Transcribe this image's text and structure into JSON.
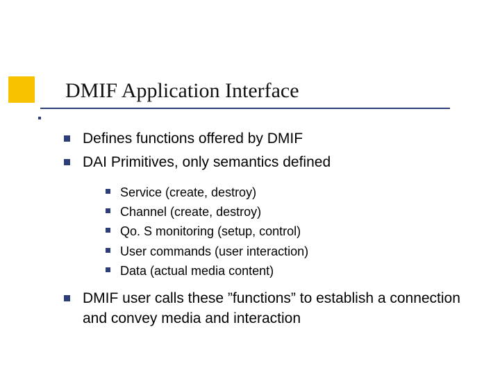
{
  "title": "DMIF Application Interface",
  "bullets": {
    "a": "Defines functions offered by DMIF",
    "b": "DAI Primitives, only semantics defined",
    "sub": {
      "s1": "Service (create, destroy)",
      "s2": "Channel (create, destroy)",
      "s3": "Qo. S monitoring (setup, control)",
      "s4": "User commands (user interaction)",
      "s5": "Data (actual media content)"
    },
    "c": "DMIF user calls these ”functions” to establish a connection and convey media and interaction"
  },
  "accent_color": "#f7c300",
  "brand_color": "#2c3e7a"
}
